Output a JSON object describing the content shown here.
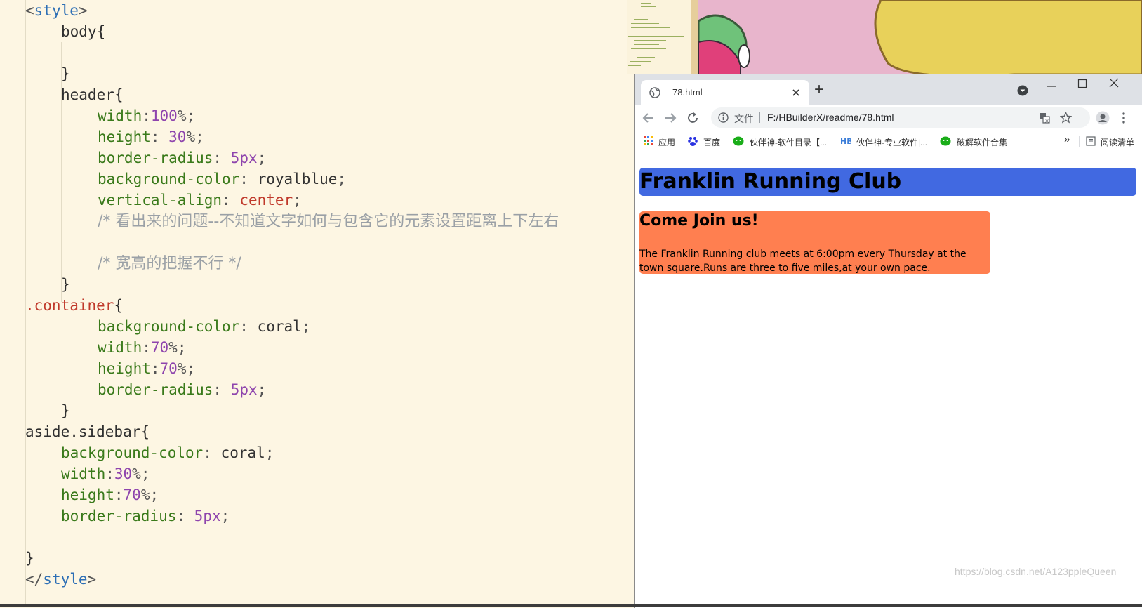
{
  "editor": {
    "lines": {
      "l1": {
        "a": "<",
        "b": "style",
        "c": ">"
      },
      "l2": {
        "a": "body{"
      },
      "l4": {
        "a": "}"
      },
      "l5": {
        "a": "header{"
      },
      "l6": {
        "p": "width",
        "s": ":",
        "n": "100",
        "u": "%;"
      },
      "l7": {
        "p": "height",
        "s": ": ",
        "n": "30",
        "u": "%;"
      },
      "l8": {
        "p": "border-radius",
        "s": ": ",
        "n": "5px",
        "u": ";"
      },
      "l9": {
        "p": "background-color",
        "s": ": ",
        "v": "royalblue",
        "u": ";"
      },
      "l10": {
        "p": "vertical-align",
        "s": ": ",
        "k": "center",
        "u": ";"
      },
      "l11": {
        "c": "/* 看出来的问题--不知道文字如何与包含它的元素设置距离上下左右"
      },
      "l13": {
        "c": "/* 宽高的把握不行 */"
      },
      "l14": {
        "a": "}"
      },
      "l15": {
        "cls": ".container",
        "a": "{"
      },
      "l16": {
        "p": "background-color",
        "s": ": ",
        "v": "coral",
        "u": ";"
      },
      "l17": {
        "p": "width",
        "s": ":",
        "n": "70",
        "u": "%;"
      },
      "l18": {
        "p": "height",
        "s": ":",
        "n": "70",
        "u": "%;"
      },
      "l19": {
        "p": "border-radius",
        "s": ": ",
        "n": "5px",
        "u": ";"
      },
      "l20": {
        "a": "}"
      },
      "l21": {
        "a": "aside.sidebar{"
      },
      "l22": {
        "p": "background-color",
        "s": ": ",
        "v": "coral",
        "u": ";"
      },
      "l23": {
        "p": "width",
        "s": ":",
        "n": "30",
        "u": "%;"
      },
      "l24": {
        "p": "height",
        "s": ":",
        "n": "70",
        "u": "%;"
      },
      "l25": {
        "p": "border-radius",
        "s": ": ",
        "n": "5px",
        "u": ";"
      },
      "l27": {
        "a": "}"
      },
      "l28": {
        "a": "</",
        "b": "style",
        "c": ">"
      }
    }
  },
  "browser": {
    "tab_title": "78.html",
    "new_tab": "+",
    "url_prefix": "文件",
    "url": "F:/HBuilderX/readme/78.html",
    "bookmarks": {
      "apps": "应用",
      "baidu": "百度",
      "b1": "伙伴神-软件目录【...",
      "b2": "伙伴神-专业软件|...",
      "b3": "破解软件合集",
      "more": "»",
      "reading_list": "阅读清单"
    },
    "page": {
      "header": "Franklin Running Club",
      "container_title": "Come Join us!",
      "container_text": "The Franklin Running club meets at 6:00pm every Thursday at the town square.Runs are three to five miles,at your own pace."
    }
  },
  "watermark": "https://blog.csdn.net/A123ppleQueen",
  "colors": {
    "header_bg": "#4169e1",
    "container_bg": "#ff7f50",
    "editor_bg": "#fdf6e3"
  },
  "icons": [
    "globe-icon",
    "close-icon",
    "chevron-down-icon",
    "minimize-icon",
    "maximize-icon",
    "back-icon",
    "forward-icon",
    "reload-icon",
    "info-icon",
    "translate-icon",
    "star-icon",
    "profile-icon",
    "menu-icon",
    "apps-icon",
    "baidu-icon",
    "wechat-icon",
    "reading-list-icon"
  ]
}
